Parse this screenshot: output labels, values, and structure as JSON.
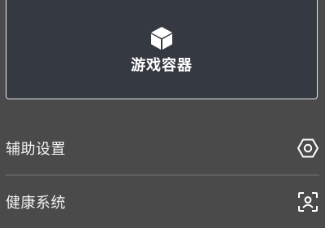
{
  "card": {
    "label": "游戏容器",
    "icon": "cube-icon"
  },
  "menu": {
    "items": [
      {
        "label": "辅助设置",
        "icon": "hexagon-settings-icon"
      },
      {
        "label": "健康系统",
        "icon": "face-scan-icon"
      }
    ]
  },
  "colors": {
    "background": "#4a4a4a",
    "card_background": "#353a42",
    "card_border": "#e9e9e9",
    "text": "#ffffff",
    "divider": "#5e5e5e"
  }
}
